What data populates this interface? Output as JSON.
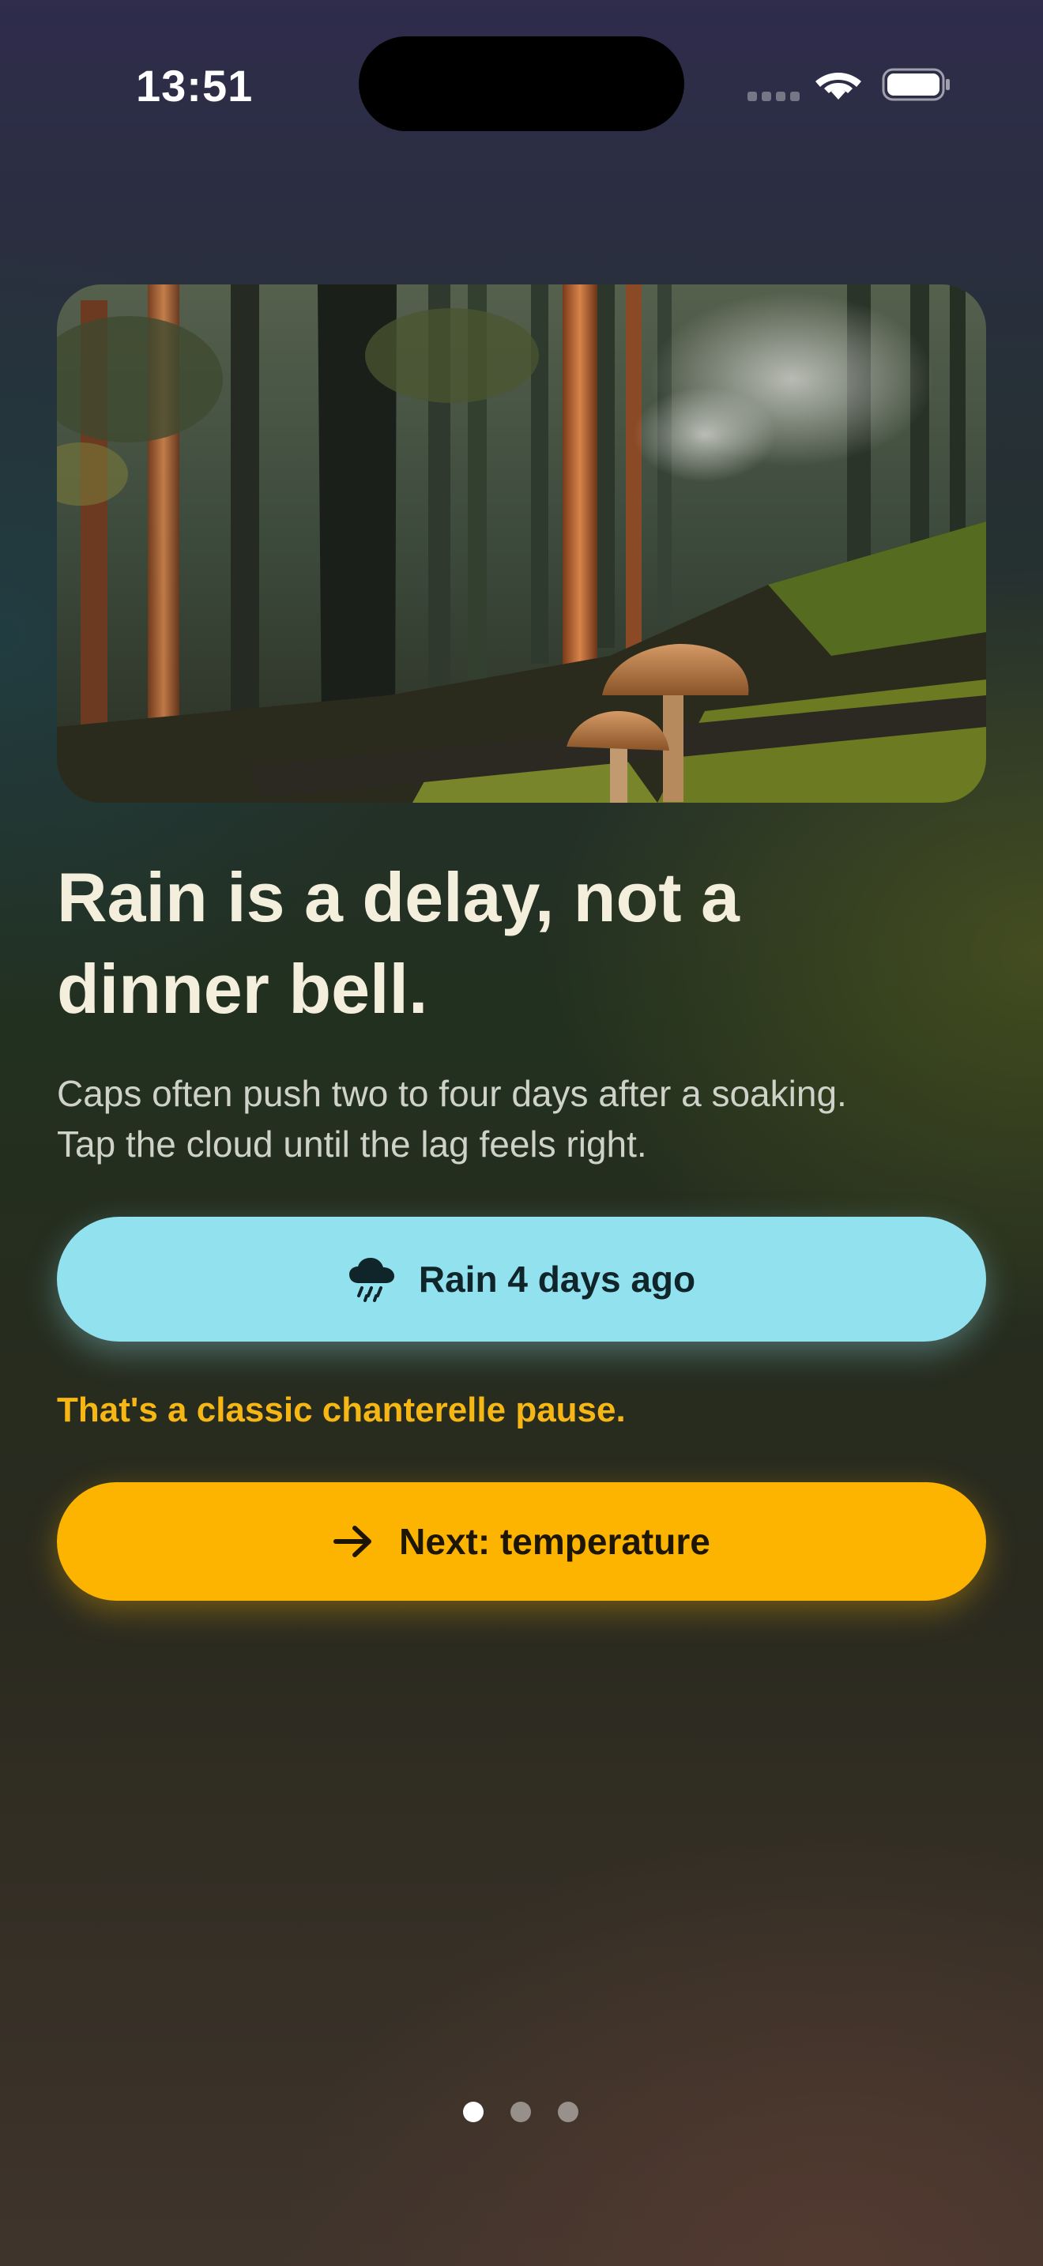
{
  "status_bar": {
    "time": "13:51"
  },
  "hero": {
    "image_description_icon": "forest-mushroom-image"
  },
  "onboarding": {
    "headline_line1": "Rain is a delay, not a",
    "headline_line2": "dinner bell.",
    "subtext_line1": "Caps often push two to four days after a soaking.",
    "subtext_line2": "Tap the cloud until the lag feels right.",
    "rain_button": {
      "icon": "cloud-rain-icon",
      "label": "Rain 4 days ago"
    },
    "feedback": "That's a classic chanterelle pause.",
    "next_button": {
      "icon": "arrow-right-icon",
      "label": "Next: temperature"
    }
  },
  "pagination": {
    "total": 3,
    "active_index": 0
  },
  "colors": {
    "rain_button": "#92e1ef",
    "next_button": "#fdb400",
    "feedback_text": "#f6b614",
    "headline_text": "#f4efdc"
  }
}
